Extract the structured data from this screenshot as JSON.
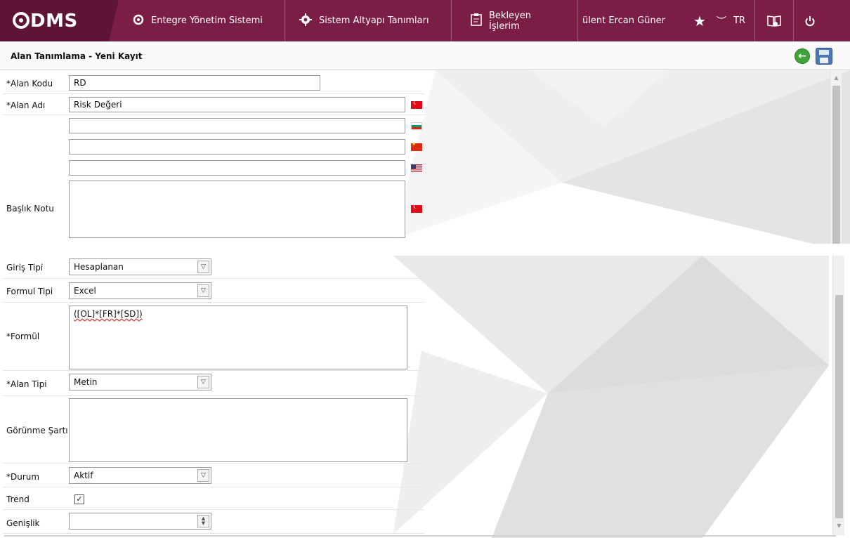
{
  "app": {
    "logo": "DMS",
    "user": "ülent Ercan Güner",
    "language": "TR"
  },
  "nav": {
    "item1": "Entegre Yönetim Sistemi",
    "item2": "Sistem Altyapı Tanımları",
    "item3": "Bekleyen İşlerim"
  },
  "page": {
    "title": "Alan Tanımlama - Yeni Kayıt"
  },
  "form": {
    "alan_kodu": {
      "label": "*Alan Kodu",
      "value": "RD"
    },
    "alan_adi": {
      "label": "*Alan Adı",
      "value_tr": "Risk Değeri",
      "value_bg": "",
      "value_cn": "",
      "value_us": ""
    },
    "baslik_notu": {
      "label": "Başlık Notu",
      "value": ""
    },
    "giris_tipi": {
      "label": "Giriş Tipi",
      "value": "Hesaplanan"
    },
    "formul_tipi": {
      "label": "Formul Tipi",
      "value": "Excel"
    },
    "formul": {
      "label": "*Formül",
      "value": "([OL]*[FR]*[SD])"
    },
    "alan_tipi": {
      "label": "*Alan Tipi",
      "value": "Metin"
    },
    "gorunme_sarti": {
      "label": "Görünme Şartı",
      "value": ""
    },
    "durum": {
      "label": "*Durum",
      "value": "Aktif"
    },
    "trend": {
      "label": "Trend",
      "checked": true
    },
    "genislik": {
      "label": "Genişlik",
      "value": ""
    }
  },
  "icons": {
    "logo": "logo-q-icon",
    "nav1": "q-circle-icon",
    "nav2": "gear-icon",
    "nav3": "clipboard-icon",
    "star": "star-icon",
    "chevron": "chevron-down-icon",
    "book": "book-icon",
    "power": "power-icon",
    "back": "back-arrow-icon",
    "save": "save-disk-icon"
  },
  "colors": {
    "topbar": "#7a1e45",
    "logo_bg": "#5e1535",
    "back_green": "#3fa43a",
    "save_blue": "#4d78b8"
  }
}
